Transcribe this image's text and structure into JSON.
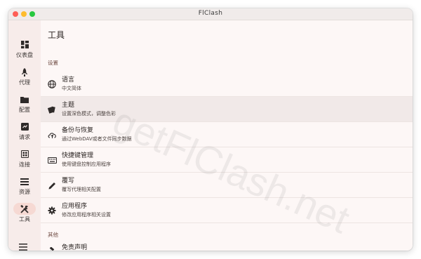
{
  "window": {
    "title": "FlClash"
  },
  "sidebar": {
    "items": [
      {
        "label": "仪表盘",
        "icon": "dashboard-icon",
        "active": false
      },
      {
        "label": "代理",
        "icon": "rocket-icon",
        "active": false
      },
      {
        "label": "配置",
        "icon": "folder-icon",
        "active": false
      },
      {
        "label": "请求",
        "icon": "request-icon",
        "active": false
      },
      {
        "label": "连接",
        "icon": "connection-icon",
        "active": false
      },
      {
        "label": "资源",
        "icon": "list-icon",
        "active": false
      },
      {
        "label": "工具",
        "icon": "tools-icon",
        "active": true
      }
    ],
    "menu_icon": "hamburger-menu-icon"
  },
  "main": {
    "title": "工具",
    "sections": [
      {
        "label": "设置",
        "rows": [
          {
            "title": "语言",
            "subtitle": "中文简体",
            "icon": "globe-icon"
          },
          {
            "title": "主题",
            "subtitle": "设置深色模式，调整色彩",
            "icon": "theme-cards-icon"
          },
          {
            "title": "备份与恢复",
            "subtitle": "通过WebDAV或者文件同步数据",
            "icon": "cloud-sync-icon"
          },
          {
            "title": "快捷键管理",
            "subtitle": "使用键盘控制应用程序",
            "icon": "keyboard-icon"
          },
          {
            "title": "覆写",
            "subtitle": "覆写代理相关配置",
            "icon": "pencil-icon"
          },
          {
            "title": "应用程序",
            "subtitle": "修改应用程序相关设置",
            "icon": "gear-icon"
          }
        ]
      },
      {
        "label": "其他",
        "rows": [
          {
            "title": "免责声明",
            "subtitle": "",
            "icon": "gavel-icon"
          }
        ]
      }
    ]
  },
  "watermark": "getFlClash.net",
  "colors": {
    "accent_pill": "#f6d9d3",
    "section_label": "#6f4b43",
    "selected_row": "#f1e9e8"
  }
}
